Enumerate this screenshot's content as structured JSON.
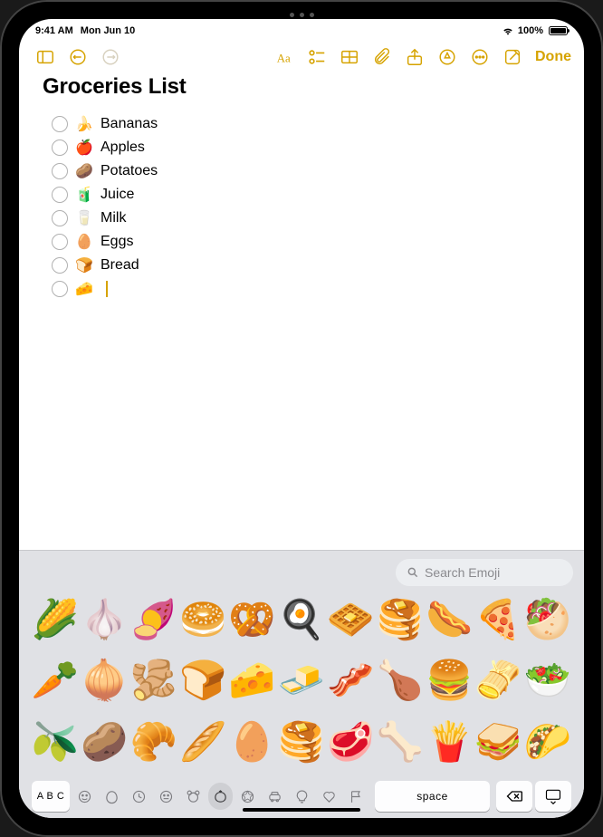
{
  "status": {
    "time": "9:41 AM",
    "date": "Mon Jun 10",
    "battery_pct": "100%"
  },
  "toolbar": {
    "done": "Done"
  },
  "note": {
    "title": "Groceries List",
    "items": [
      {
        "emoji": "🍌",
        "label": "Bananas"
      },
      {
        "emoji": "🍎",
        "label": "Apples"
      },
      {
        "emoji": "🥔",
        "label": "Potatoes"
      },
      {
        "emoji": "🧃",
        "label": "Juice"
      },
      {
        "emoji": "🥛",
        "label": "Milk"
      },
      {
        "emoji": "🥚",
        "label": "Eggs"
      },
      {
        "emoji": "🍞",
        "label": "Bread"
      },
      {
        "emoji": "🧀",
        "label": ""
      }
    ]
  },
  "keyboard": {
    "search_placeholder": "Search Emoji",
    "abc": "A B C",
    "space": "space",
    "emojis": {
      "row1": [
        "🌽",
        "🧄",
        "🍠",
        "🥯",
        "🥨",
        "🍳",
        "🧇",
        "🥞",
        "🌭",
        "🍕",
        "🥙"
      ],
      "row2": [
        "🥕",
        "🧅",
        "🫚",
        "🍞",
        "🧀",
        "🧈",
        "🥓",
        "🍗",
        "🍔",
        "🫔",
        "🥗"
      ],
      "row3": [
        "🫒",
        "🥔",
        "🥐",
        "🥖",
        "🥚",
        "🥞",
        "🥩",
        "🦴",
        "🍟",
        "🥪",
        "🌮"
      ]
    },
    "categories": [
      "frequently-used",
      "smileys",
      "animals",
      "food",
      "activity",
      "travel",
      "objects",
      "symbols",
      "flags"
    ]
  }
}
